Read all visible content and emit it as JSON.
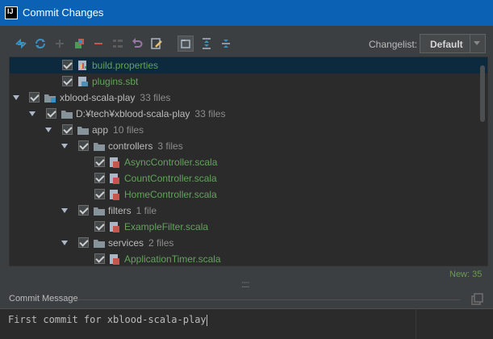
{
  "window": {
    "title": "Commit Changes",
    "logo_text": "IJ"
  },
  "toolbar": {
    "buttons": [
      "diff-icon",
      "refresh-icon",
      "add-icon",
      "move-icon",
      "remove-icon",
      "group-icon",
      "rollback-icon",
      "edit-icon",
      "show-directories-icon",
      "expand-all-icon",
      "collapse-all-icon"
    ],
    "changelist_label": "Changelist:",
    "changelist_value": "Default"
  },
  "tree": {
    "rows": [
      {
        "label": "build.properties",
        "count": "",
        "type": "file",
        "color": "green"
      },
      {
        "label": "plugins.sbt",
        "count": "",
        "type": "file",
        "color": "green"
      },
      {
        "label": "xblood-scala-play",
        "count": "33 files",
        "type": "module"
      },
      {
        "label": "D:¥tech¥xblood-scala-play",
        "count": "33 files",
        "type": "folder"
      },
      {
        "label": "app",
        "count": "10 files",
        "type": "folder"
      },
      {
        "label": "controllers",
        "count": "3 files",
        "type": "folder"
      },
      {
        "label": "AsyncController.scala",
        "count": "",
        "type": "scala",
        "color": "green"
      },
      {
        "label": "CountController.scala",
        "count": "",
        "type": "scala",
        "color": "green"
      },
      {
        "label": "HomeController.scala",
        "count": "",
        "type": "scala",
        "color": "green"
      },
      {
        "label": "filters",
        "count": "1 file",
        "type": "folder"
      },
      {
        "label": "ExampleFilter.scala",
        "count": "",
        "type": "scala",
        "color": "green"
      },
      {
        "label": "services",
        "count": "2 files",
        "type": "folder"
      },
      {
        "label": "ApplicationTimer.scala",
        "count": "",
        "type": "scala",
        "color": "green"
      }
    ]
  },
  "status": {
    "new_count": "New: 35"
  },
  "commit": {
    "label": "Commit Message",
    "message": "First commit for xblood-scala-play"
  }
}
